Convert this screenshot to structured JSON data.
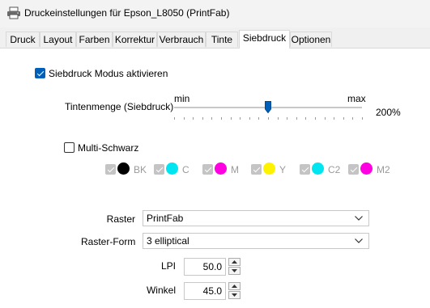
{
  "window": {
    "title": "Druckeinstellungen für Epson_L8050 (PrintFab)"
  },
  "tabs": [
    {
      "label": "Druck"
    },
    {
      "label": "Layout"
    },
    {
      "label": "Farben"
    },
    {
      "label": "Korrektur"
    },
    {
      "label": "Verbrauch"
    },
    {
      "label": "Tinte"
    },
    {
      "label": "Siebdruck",
      "active": true
    },
    {
      "label": "Optionen"
    }
  ],
  "screen_print": {
    "enable_label": "Siebdruck Modus aktivieren",
    "enable_checked": true
  },
  "ink_amount": {
    "label": "Tintenmenge (Siebdruck)",
    "min_label": "min",
    "max_label": "max",
    "value_label": "200%",
    "level_fraction": 0.5
  },
  "multi_black": {
    "label": "Multi-Schwarz",
    "checked": false
  },
  "channels": [
    {
      "label": "BK",
      "color": "#000000",
      "checked": true
    },
    {
      "label": "C",
      "color": "#00e5f0",
      "checked": true
    },
    {
      "label": "M",
      "color": "#ff00e0",
      "checked": true
    },
    {
      "label": "Y",
      "color": "#fff200",
      "checked": true
    },
    {
      "label": "C2",
      "color": "#00e5f0",
      "checked": true
    },
    {
      "label": "M2",
      "color": "#ff00e0",
      "checked": true
    }
  ],
  "raster": {
    "label": "Raster",
    "value": "PrintFab"
  },
  "raster_form": {
    "label": "Raster-Form",
    "value": "3 elliptical"
  },
  "lpi": {
    "label": "LPI",
    "value": "50.0"
  },
  "angle": {
    "label": "Winkel",
    "value": "45.0"
  },
  "colors": {
    "accent": "#005fb8",
    "panel_bg": "#ffffff",
    "window_bg": "#f0f0f0"
  },
  "icons": {
    "app": "printer-icon",
    "dropdown": "chevron-down-icon",
    "spin_up": "arrow-up-icon",
    "spin_down": "arrow-down-icon"
  }
}
